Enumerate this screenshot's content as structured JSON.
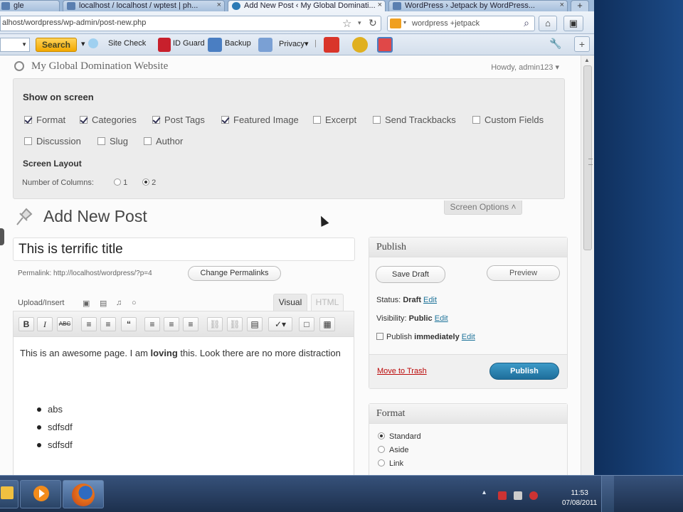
{
  "browser": {
    "tabs": [
      {
        "label": "gle",
        "active": false
      },
      {
        "label": "localhost / localhost / wptest | ph...",
        "active": false
      },
      {
        "label": "Add New Post ‹ My Global Dominati...",
        "active": true
      },
      {
        "label": "WordPress › Jetpack by WordPress...",
        "active": false
      }
    ],
    "new_tab": "+",
    "url": "alhost/wordpress/wp-admin/post-new.php",
    "search_query": "wordpress +jetpack"
  },
  "toolbar": {
    "search_label": "Search",
    "site_check": "Site Check",
    "id_guard": "ID Guard",
    "backup": "Backup",
    "privacy": "Privacy▾"
  },
  "wp": {
    "site_name": "My Global Domination Website",
    "howdy": "Howdy, admin123 ▾",
    "screen_options": {
      "heading": "Show on screen",
      "checkboxes": [
        {
          "label": "Format",
          "checked": true
        },
        {
          "label": "Categories",
          "checked": true
        },
        {
          "label": "Post Tags",
          "checked": true
        },
        {
          "label": "Featured Image",
          "checked": true
        },
        {
          "label": "Excerpt",
          "checked": false
        },
        {
          "label": "Send Trackbacks",
          "checked": false
        },
        {
          "label": "Custom Fields",
          "checked": false
        },
        {
          "label": "Discussion",
          "checked": false
        },
        {
          "label": "Slug",
          "checked": false
        },
        {
          "label": "Author",
          "checked": false
        }
      ],
      "layout_heading": "Screen Layout",
      "columns_label": "Number of Columns:",
      "col_1": "1",
      "col_2": "2",
      "tab_label": "Screen Options ˄"
    },
    "page_title": "Add New Post",
    "post_title": "This is terrific title",
    "permalink_label": "Permalink: http://localhost/wordpress/?p=4",
    "change_permalinks": "Change Permalinks",
    "upload_insert": "Upload/Insert",
    "tab_visual": "Visual",
    "tab_html": "HTML",
    "editor_buttons": [
      "B",
      "I",
      "ABC",
      "≡",
      "≡",
      "“",
      "≡",
      "≡",
      "≡",
      "⛓",
      "⛓",
      "▤",
      "✓▾",
      "□",
      "▦"
    ],
    "content_text_1": "This is an awesome page. I am ",
    "content_bold": "loving",
    "content_text_2": " this. Look there are no more distraction",
    "list_items": [
      "abs",
      "sdfsdf",
      "sdfsdf"
    ],
    "publish": {
      "title": "Publish",
      "save_draft": "Save Draft",
      "preview": "Preview",
      "status_label": "Status:",
      "status_value": "Draft",
      "visibility_label": "Visibility:",
      "visibility_value": "Public",
      "publish_label": "Publish",
      "publish_value": "immediately",
      "edit": "Edit",
      "move_to_trash": "Move to Trash",
      "publish_button": "Publish"
    },
    "format": {
      "title": "Format",
      "options": [
        {
          "label": "Standard",
          "selected": true
        },
        {
          "label": "Aside",
          "selected": false
        },
        {
          "label": "Link",
          "selected": false
        }
      ]
    }
  },
  "taskbar": {
    "clock_time": "11:53",
    "clock_date": "07/08/2011"
  }
}
